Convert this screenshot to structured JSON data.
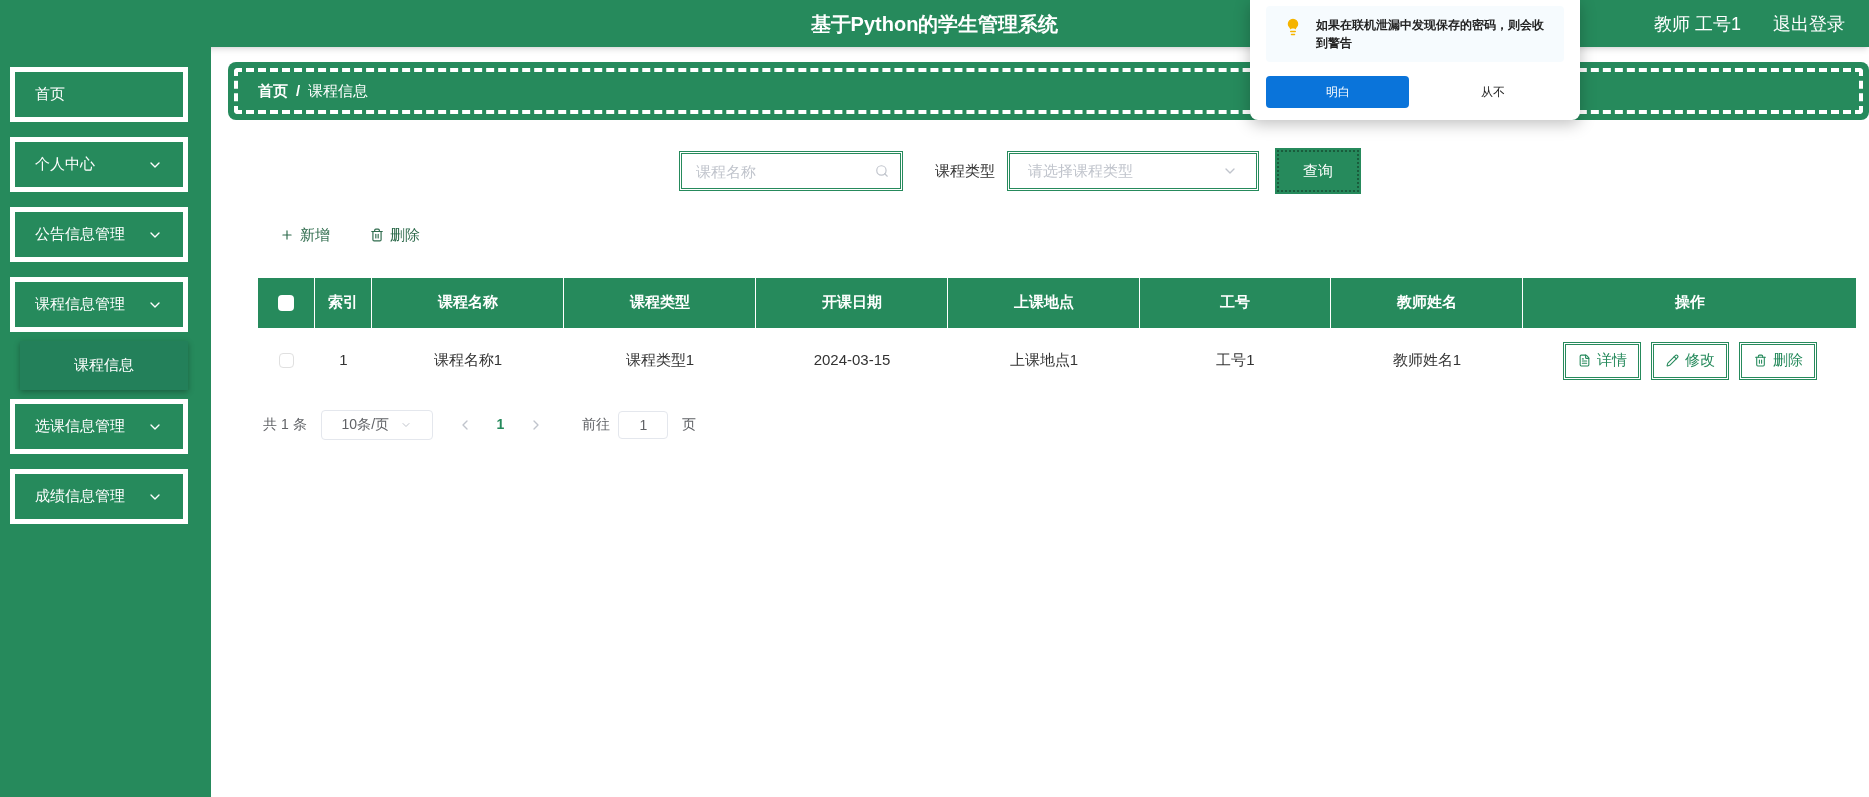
{
  "header": {
    "title": "基于Python的学生管理系统",
    "user": "教师 工号1",
    "logout": "退出登录"
  },
  "sidebar": {
    "items": [
      {
        "label": "首页",
        "expandable": false
      },
      {
        "label": "个人中心",
        "expandable": true
      },
      {
        "label": "公告信息管理",
        "expandable": true
      },
      {
        "label": "课程信息管理",
        "expandable": true,
        "children": [
          {
            "label": "课程信息",
            "selected": true
          }
        ]
      },
      {
        "label": "选课信息管理",
        "expandable": true
      },
      {
        "label": "成绩信息管理",
        "expandable": true
      }
    ]
  },
  "breadcrumb": [
    "首页",
    "课程信息"
  ],
  "breadcrumb_separator": "/",
  "search": {
    "name_placeholder": "课程名称",
    "type_label": "课程类型",
    "type_placeholder": "请选择课程类型",
    "button": "查询"
  },
  "actions": [
    "新增",
    "删除"
  ],
  "table": {
    "all_checked": false,
    "columns": [
      "索引",
      "课程名称",
      "课程类型",
      "开课日期",
      "上课地点",
      "工号",
      "教师姓名",
      "操作"
    ],
    "rows": [
      {
        "checked": false,
        "cells": [
          "1",
          "课程名称1",
          "课程类型1",
          "2024-03-15",
          "上课地点1",
          "工号1",
          "教师姓名1"
        ],
        "buttons": [
          "详情",
          "修改",
          "删除"
        ]
      }
    ]
  },
  "pagination": {
    "total": "共 1 条",
    "page_size": "10条/页",
    "pages": [
      {
        "label": "1",
        "selected": true
      }
    ],
    "goto_label": "前往",
    "goto_value": "1",
    "goto_suffix": "页"
  },
  "popup": {
    "message": "如果在联机泄漏中发现保存的密码，则会收到警告",
    "primary": "明白",
    "secondary": "从不"
  }
}
